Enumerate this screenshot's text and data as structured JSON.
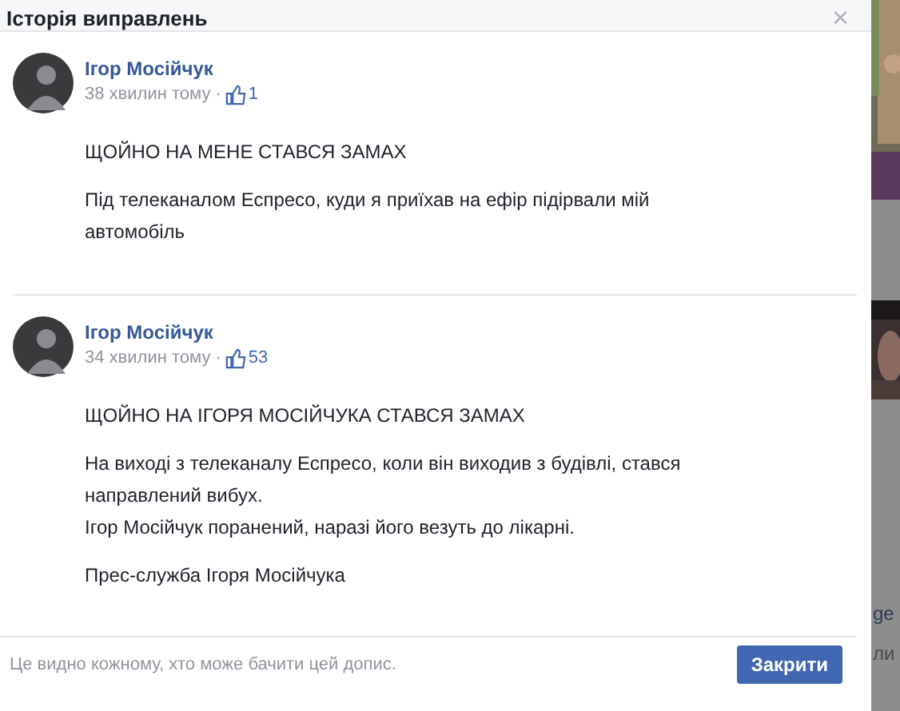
{
  "dialog": {
    "title": "Історія виправлень",
    "close": "×"
  },
  "posts": [
    {
      "author": "Ігор Мосійчук",
      "time": "38 хвилин тому",
      "separator": "·",
      "likes": "1",
      "paragraphs": [
        [
          "ЩОЙНО НА МЕНЕ СТАВСЯ ЗАМАХ"
        ],
        [
          "Під телеканалом Еспресо, куди я приїхав на ефір підірвали мій",
          "автомобіль"
        ]
      ]
    },
    {
      "author": "Ігор Мосійчук",
      "time": "34 хвилин тому",
      "separator": "·",
      "likes": "53",
      "paragraphs": [
        [
          "ЩОЙНО НА ІГОРЯ МОСІЙЧУКА СТАВСЯ ЗАМАХ"
        ],
        [
          "На виході з телеканалу Еспресо, коли він виходив з будівлі, стався",
          "направлений вибух.",
          "Ігор Мосійчук поранений, наразі його везуть до лікарні."
        ],
        [
          "Прес-служба Ігоря Мосійчука"
        ]
      ]
    }
  ],
  "footer": {
    "note": "Це видно кожному, хто може бачити цей допис.",
    "button": "Закрити"
  },
  "background": {
    "texts": [
      "ge",
      "ли"
    ]
  }
}
